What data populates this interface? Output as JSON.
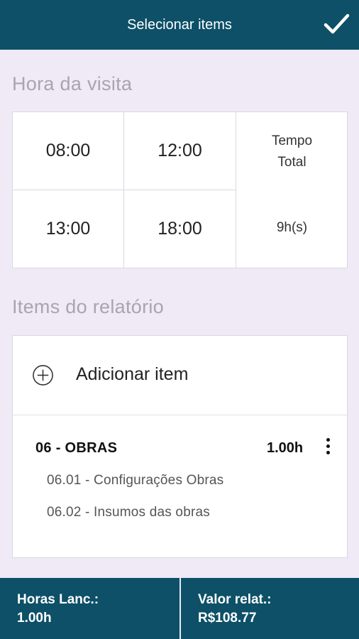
{
  "header": {
    "title": "Selecionar items",
    "confirm_icon": "check-icon"
  },
  "visit": {
    "section_title": "Hora da visita",
    "times": [
      "08:00",
      "12:00",
      "13:00",
      "18:00"
    ],
    "total_label_line1": "Tempo",
    "total_label_line2": "Total",
    "total_value": "9h(s)"
  },
  "items": {
    "section_title": "Items do relatório",
    "add_label": "Adicionar item",
    "add_icon": "plus-circle-icon",
    "group": {
      "code": "06 - OBRAS",
      "hours": "1.00h",
      "menu_icon": "more-vertical-icon",
      "subitems": [
        "06.01 - Configurações Obras",
        "06.02 - Insumos das obras"
      ]
    }
  },
  "footer": {
    "hours_label": "Horas Lanc.:",
    "hours_value": "1.00h",
    "value_label": "Valor relat.:",
    "value_value": "R$108.77"
  },
  "colors": {
    "primary": "#0d5068",
    "background": "#efeaf6",
    "muted_title": "#a9a3b2"
  }
}
